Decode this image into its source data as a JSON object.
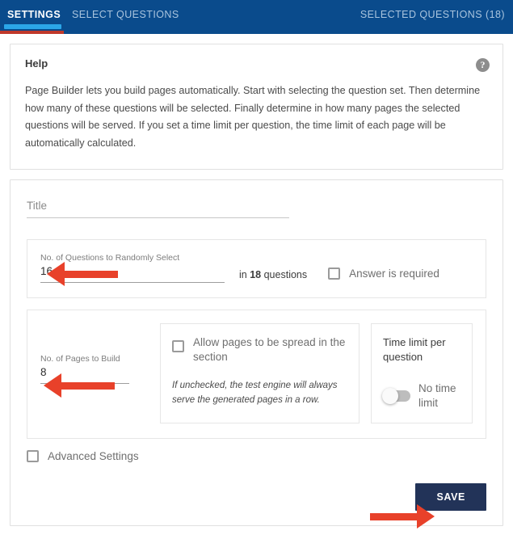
{
  "header": {
    "tabs": [
      {
        "label": "SETTINGS",
        "active": true
      },
      {
        "label": "SELECT QUESTIONS",
        "active": false
      },
      {
        "label": "SELECTED QUESTIONS (18)",
        "active": false
      }
    ],
    "background_color": "#0a4b8c",
    "active_indicator_color": "#2ba6e8"
  },
  "help": {
    "title": "Help",
    "icon": "question-mark-icon",
    "body": "Page Builder lets you build pages automatically. Start with selecting the question set. Then determine how many of these questions will be selected. Finally determine in how many pages the selected questions will be served. If you set a time limit per question, the time limit of each page will be automatically calculated."
  },
  "form": {
    "title_field": {
      "placeholder": "Title",
      "value": ""
    },
    "questions": {
      "label": "No. of Questions to Randomly Select",
      "value": "16",
      "in_text_prefix": "in",
      "total": "18",
      "in_text_suffix": "questions",
      "answer_required_label": "Answer is required",
      "answer_required_checked": false
    },
    "pages": {
      "label": "No. of Pages to Build",
      "value": "8",
      "spread_label": "Allow pages to be spread in the section",
      "spread_checked": false,
      "spread_hint": "If unchecked, the test engine will always serve the generated pages in a row.",
      "time_limit_title": "Time limit per question",
      "time_limit_toggle_label": "No time limit",
      "time_limit_toggle_on": false
    },
    "advanced": {
      "label": "Advanced Settings",
      "checked": false
    },
    "save_label": "SAVE"
  },
  "annotations": {
    "arrow_color": "#e8412a",
    "arrows": [
      {
        "name": "arrow-to-questions-count",
        "direction": "left"
      },
      {
        "name": "arrow-to-pages-count",
        "direction": "left"
      },
      {
        "name": "arrow-to-save-button",
        "direction": "right"
      }
    ]
  },
  "colors": {
    "header_blue": "#0a4b8c",
    "accent_cyan": "#2ba6e8",
    "save_navy": "#223358",
    "annotation_red": "#e8412a"
  }
}
